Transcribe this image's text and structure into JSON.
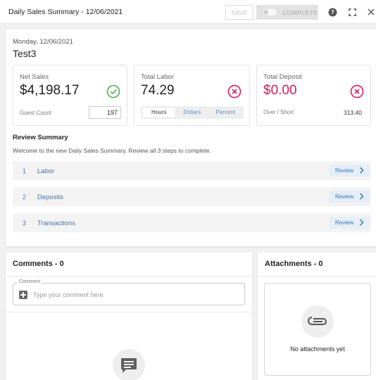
{
  "header": {
    "title": "Daily Sales Summary - 12/06/2021",
    "save_label": "SAVE",
    "complete_label": "COMPLETE"
  },
  "summary": {
    "date": "Monday, 12/06/2021",
    "store": "Test3"
  },
  "stats": {
    "net_sales": {
      "label": "Net Sales",
      "value": "$4,198.17",
      "sub_label": "Guest Count",
      "sub_value": "197",
      "status": "ok"
    },
    "total_labor": {
      "label": "Total Labor",
      "value": "74.29",
      "status": "error",
      "toggle_options": [
        "Hours",
        "Dollars",
        "Percent"
      ],
      "toggle_selected": "Hours"
    },
    "total_deposit": {
      "label": "Total Deposit",
      "value": "$0.00",
      "sub_label": "Over / Short",
      "sub_value": "313.40",
      "status": "error"
    }
  },
  "review": {
    "heading": "Review Summary",
    "description": "Welcome to the new Daily Sales Summary. Review all 3 steps to complete.",
    "button_label": "Review",
    "steps": [
      {
        "number": "1",
        "name": "Labor"
      },
      {
        "number": "2",
        "name": "Deposits"
      },
      {
        "number": "3",
        "name": "Transactions"
      }
    ]
  },
  "comments": {
    "title": "Comments - 0",
    "field_label": "Comment",
    "placeholder": "Type your comment here"
  },
  "attachments": {
    "title": "Attachments - 0",
    "empty_text": "No attachments yet"
  },
  "colors": {
    "success": "#4caf50",
    "error": "#d81b60",
    "link": "#3b74b8"
  },
  "icons": [
    "help-icon",
    "fullscreen-icon",
    "close-icon",
    "check-circle-icon",
    "error-circle-icon",
    "chevron-right-icon",
    "add-comment-icon",
    "comment-icon",
    "paperclip-icon"
  ]
}
